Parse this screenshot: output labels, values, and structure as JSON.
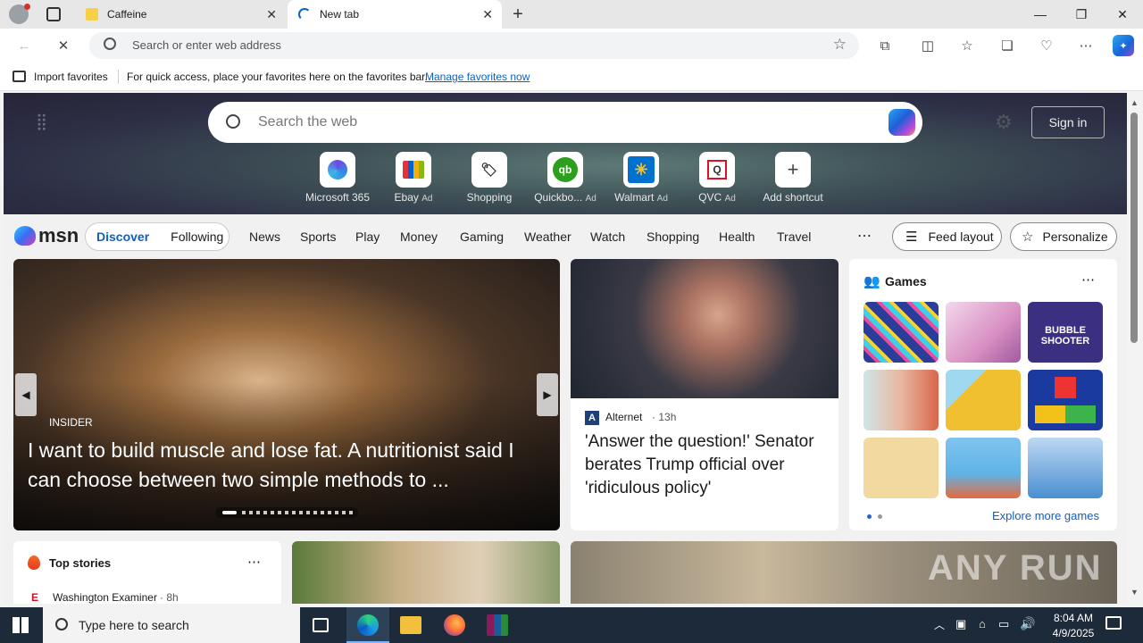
{
  "browser": {
    "tabs": [
      {
        "title": "Caffeine",
        "active": false
      },
      {
        "title": "New tab",
        "active": true
      }
    ],
    "address_placeholder": "Search or enter web address",
    "favbar": {
      "import_label": "Import favorites",
      "message": "For quick access, place your favorites here on the favorites bar.",
      "manage_link": "Manage favorites now"
    }
  },
  "msn": {
    "search_placeholder": "Search the web",
    "signin_label": "Sign in",
    "logo_text": "msn",
    "shortcuts": [
      {
        "label": "Microsoft 365",
        "ad": ""
      },
      {
        "label": "Ebay",
        "ad": "Ad"
      },
      {
        "label": "Shopping",
        "ad": ""
      },
      {
        "label": "Quickbo...",
        "ad": "Ad"
      },
      {
        "label": "Walmart",
        "ad": "Ad"
      },
      {
        "label": "QVC",
        "ad": "Ad"
      },
      {
        "label": "Add shortcut",
        "ad": ""
      }
    ],
    "feed_tabs": {
      "discover": "Discover",
      "following": "Following"
    },
    "nav": [
      "News",
      "Sports",
      "Play",
      "Money",
      "Gaming",
      "Weather",
      "Watch",
      "Shopping",
      "Health",
      "Travel"
    ],
    "feed_layout_label": "Feed layout",
    "personalize_label": "Personalize",
    "hero_story": {
      "source": "INSIDER",
      "headline": "I want to build muscle and lose fat. A nutritionist said I can choose between two simple methods to ..."
    },
    "side_story": {
      "source": "Alternet",
      "age": "13h",
      "headline": "'Answer the question!' Senator berates Trump official over 'ridiculous policy'"
    },
    "games": {
      "title": "Games",
      "explore_label": "Explore more games",
      "tile_colors": [
        "#2a3d9a",
        "#d88fc2",
        "#3b2f82",
        "#e8b7a0",
        "#f0c030",
        "#1b3aa0",
        "#f2d9a0",
        "#5fb3e6",
        "#4a8fd1"
      ],
      "bubble_text": "BUBBLE SHOOTER"
    },
    "top_stories": {
      "title": "Top stories",
      "first_source": "Washington Examiner",
      "first_age": "8h"
    }
  },
  "taskbar": {
    "search_placeholder": "Type here to search",
    "time": "8:04 AM",
    "date": "4/9/2025"
  },
  "watermark": "ANY RUN"
}
